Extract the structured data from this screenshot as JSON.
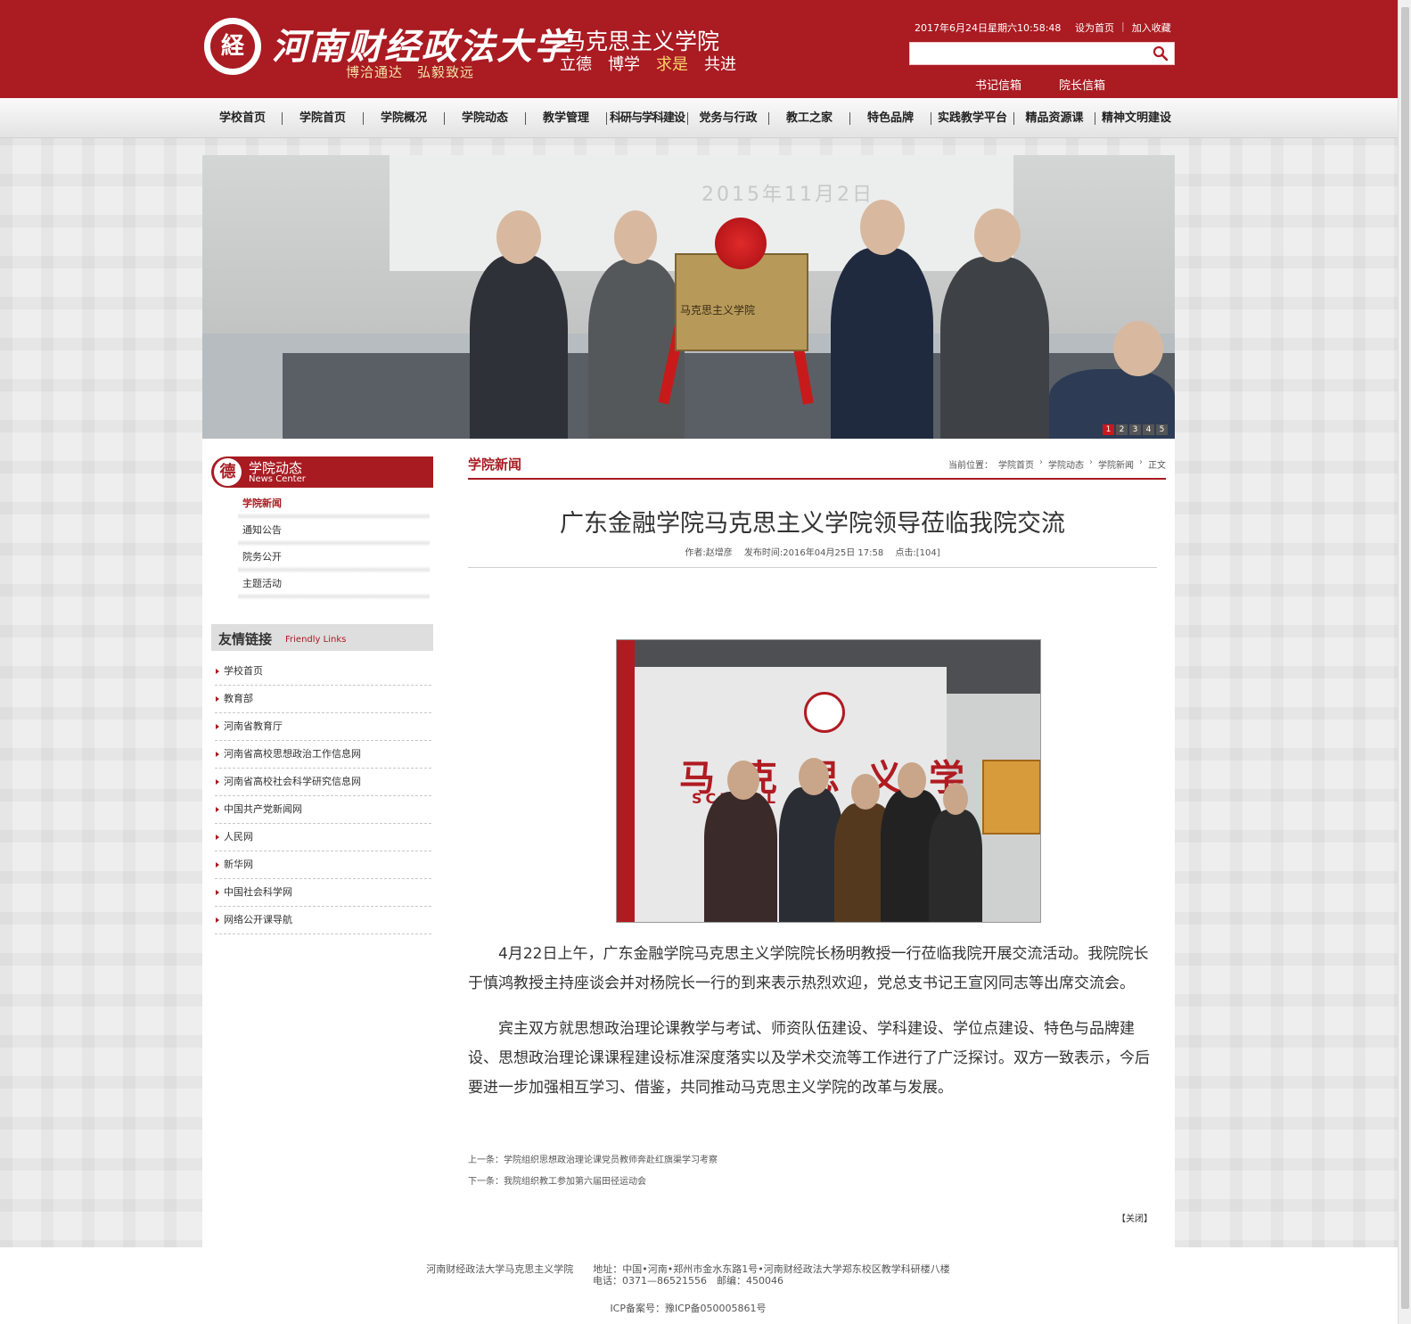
{
  "header": {
    "university_name": "河南财经政法大学",
    "motto": "博洽通达　弘毅致远",
    "school_name": "马克思主义学院",
    "values": [
      "立德",
      "博学",
      "求是",
      "共进"
    ],
    "datetime": "2017年6月24日星期六10:58:48",
    "set_home": "设为首页",
    "separator": "|",
    "add_favorite": "加入收藏",
    "search_placeholder": "",
    "secretary_mailbox": "书记信箱",
    "dean_mailbox": "院长信箱",
    "brand_color": "#aa1b22"
  },
  "nav": {
    "items": [
      "学校首页",
      "学院首页",
      "学院概况",
      "学院动态",
      "教学管理",
      "科研与学科建设",
      "党务与行政",
      "教工之家",
      "特色品牌",
      "实践教学平台",
      "精品资源课",
      "精神文明建设"
    ]
  },
  "banner": {
    "screen_date": "2015年11月2日",
    "plaque_text": "马克思主义学院",
    "dots": [
      "1",
      "2",
      "3",
      "4",
      "5"
    ],
    "active_dot": "1"
  },
  "sidebar": {
    "section_title": "学院动态",
    "section_title_en": "News Center",
    "badge_char": "德",
    "menu": [
      "学院新闻",
      "通知公告",
      "院务公开",
      "主题活动"
    ],
    "active_menu": "学院新闻",
    "links_title": "友情链接",
    "links_title_en": "Friendly Links",
    "links": [
      "学校首页",
      "教育部",
      "河南省教育厅",
      "河南省高校思想政治工作信息网",
      "河南省高校社会科学研究信息网",
      "中国共产党新闻网",
      "人民网",
      "新华网",
      "中国社会科学网",
      "网络公开课导航"
    ]
  },
  "article": {
    "column_title": "学院新闻",
    "breadcrumb": [
      "当前位置：",
      "学院首页",
      "学院动态",
      "学院新闻",
      "正文"
    ],
    "title": "广东金融学院马克思主义学院领导莅临我院交流",
    "author": "作者:赵增彦",
    "published": "发布时间:2016年04月25日 17:58",
    "clicks": "点击:[104]",
    "photo_wall_text": "马克思义学",
    "photo_wall_text_en": "SCHOOL",
    "paragraphs": [
      "4月22日上午，广东金融学院马克思主义学院院长杨明教授一行莅临我院开展交流活动。我院院长于慎鸿教授主持座谈会并对杨院长一行的到来表示热烈欢迎，党总支书记王宣冈同志等出席交流会。",
      "宾主双方就思想政治理论课教学与考试、师资队伍建设、学科建设、学位点建设、特色与品牌建设、思想政治理论课课程建设标准深度落实以及学术交流等工作进行了广泛探讨。双方一致表示，今后要进一步加强相互学习、借鉴，共同推动马克思主义学院的改革与发展。"
    ],
    "prev_label": "上一条：",
    "prev_title": "学院组织思想政治理论课党员教师奔赴红旗渠学习考察",
    "next_label": "下一条：",
    "next_title": "我院组织教工参加第六届田径运动会",
    "close": "【关闭】"
  },
  "footer": {
    "line1": "河南财经政法大学马克思主义学院　　地址：中国•河南•郑州市金水东路1号•河南财经政法大学郑东校区教学科研楼八楼",
    "line2": "电话：0371—86521556　邮编：450046",
    "line3": "ICP备案号：豫ICP备050005861号"
  }
}
